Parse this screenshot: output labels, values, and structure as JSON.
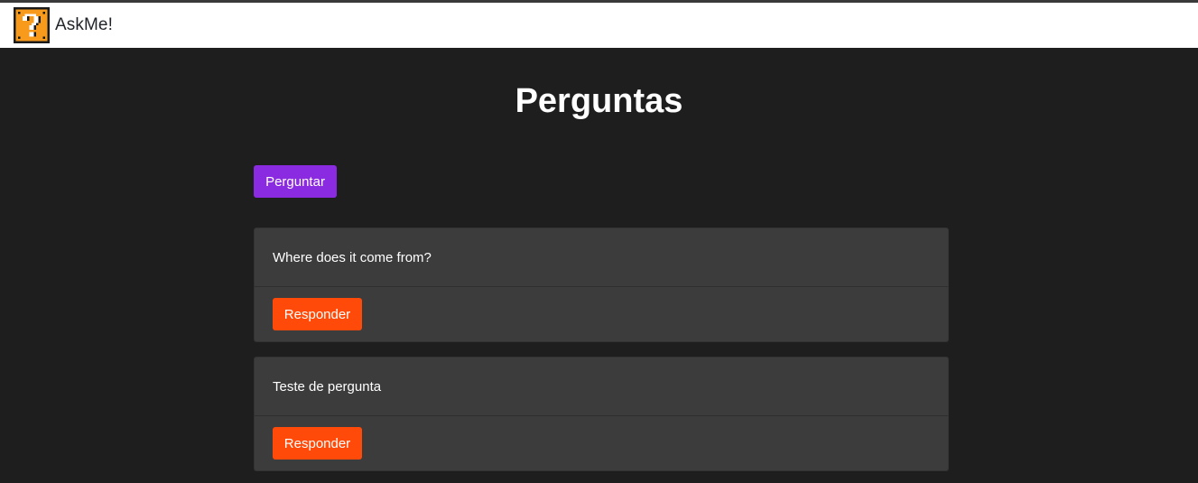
{
  "navbar": {
    "brand_text": "AskMe!",
    "logo_icon": "question-block-icon",
    "logo_colors": {
      "fill": "#f89a1c",
      "mark": "#ffffff",
      "outline": "#1a1a1a"
    }
  },
  "page": {
    "title": "Perguntas"
  },
  "actions": {
    "ask_label": "Perguntar",
    "ask_color": "#8a2be2"
  },
  "questions": [
    {
      "text": "Where does it come from?",
      "reply_label": "Responder"
    },
    {
      "text": "Teste de pergunta",
      "reply_label": "Responder"
    }
  ],
  "colors": {
    "background": "#1e1e1e",
    "card": "#3c3c3c",
    "reply_button": "#ff4a0a"
  }
}
